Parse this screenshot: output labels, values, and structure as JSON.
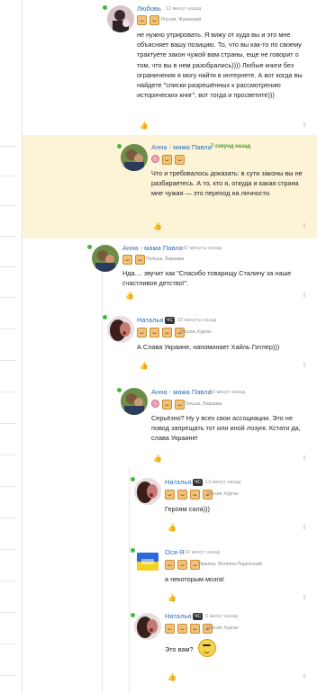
{
  "comments": [
    {
      "name": "Любовь",
      "time": "12 минут назад",
      "location": "Россия, Жуковский",
      "text": "не нужно утрировать. Я вижу от куда вы и это мне объясняет вашу позицию. То, что вы как-то по своему трактуете закон чужой вам страны, еще не говорит о том, что вы в нем разобрались)))) Любые книги без ограничения я могу найти в интернете. А вот когда вы найдете \"списки разрешённых к рассмотрению исторических книг\", вот тогда и просветите)))"
    },
    {
      "name": "Анна - мама Павла",
      "time": "7 секунд назад",
      "text": "Что и требовалось доказать: в сути законы вы не разбираетесь. А то, кто я, откуда и какая страна мне чужая — это переход на личности."
    },
    {
      "name": "Анна - мама Павла",
      "time": "42 минуты назад",
      "location": "Польша, Варшава",
      "text": "Нда.... звучит как \"Спасибо товарищу Сталину за наше счастливое детство!\"."
    },
    {
      "name": "Наталья",
      "badge": "ЧС",
      "time": "33 минуты назад",
      "location": "Россия, Курган",
      "text": "А Слава Украине, напоминает Хайль Гитлер)))"
    },
    {
      "name": "Анна - мама Павла",
      "time": "16 минут назад",
      "location": "Польша, Варшава",
      "text": "Серьёзно? Ну у всех свои ассоциации. Это не повод запрещать тот или иной лозунг. Кстати да, слава Украине!"
    },
    {
      "name": "Наталья",
      "badge": "ЧС",
      "time": "13 минут назад",
      "location": "Россия, Курган",
      "text": "Героям сала)))"
    },
    {
      "name": "Ося-Я",
      "time": "10 минут назад",
      "location": "Украина, Могилев-Подольский",
      "text": "а некоторым мозга!"
    },
    {
      "name": "Наталья",
      "badge": "ЧС",
      "time": "5 минут назад",
      "location": "Россия, Курган",
      "text": "Это вам?"
    }
  ],
  "icons": {
    "like": "thumbs-up-icon",
    "share": "share-icon",
    "emoji": "smiley-emoji"
  },
  "colors": {
    "name": "#2a72b5",
    "highlight": "#fdf4d7",
    "online": "#3cbc3c",
    "new_time": "#4a9a2a"
  }
}
